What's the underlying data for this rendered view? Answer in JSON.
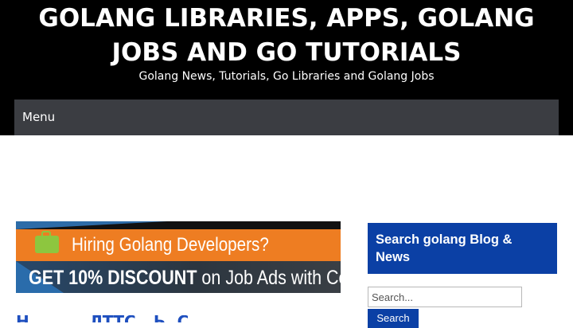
{
  "header": {
    "title_line1": "GOLANG LIBRARIES, APPS, GOLANG",
    "title_line2": "JOBS AND GO TUTORIALS",
    "tagline": "Golang News, Tutorials, Go Libraries and Golang Jobs"
  },
  "nav": {
    "menu_label": "Menu"
  },
  "banner": {
    "headline": "Hiring Golang Developers?",
    "offer_bold": "GET 10% DISCOUNT",
    "offer_rest": " on Job Ads with Coupo",
    "icon": "shopping-bag-icon"
  },
  "post": {
    "title_partial": "Н......... ЛТТС.. Ь. С."
  },
  "sidebar": {
    "widget_title": "Search golang Blog & News",
    "search_placeholder": "Search...",
    "search_button": "Search"
  },
  "colors": {
    "header_bg": "#000000",
    "nav_bg": "#3b3d42",
    "accent_blue": "#0b40a5",
    "banner_orange": "#ee7d22"
  }
}
